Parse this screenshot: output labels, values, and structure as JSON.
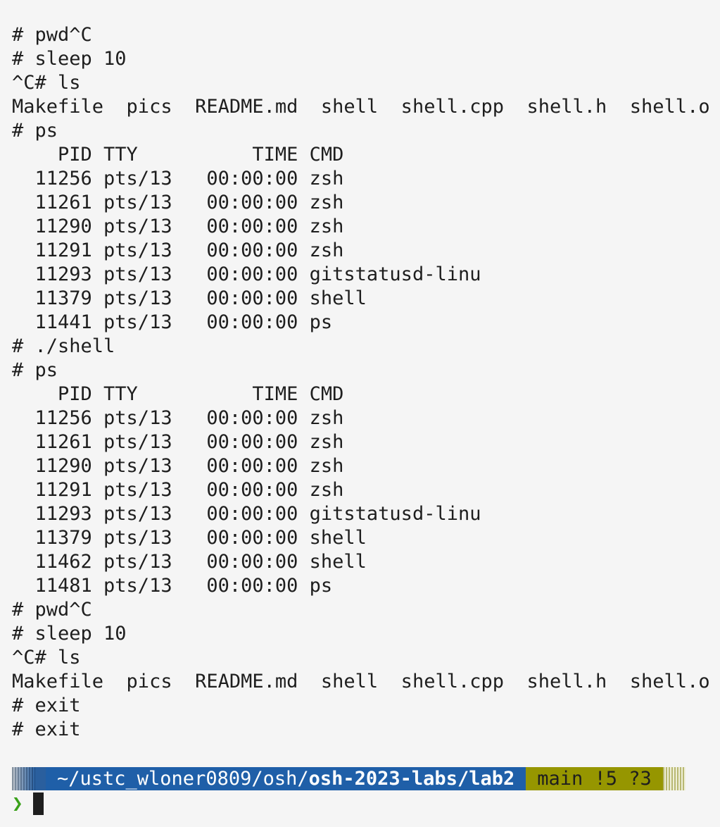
{
  "terminal": {
    "lines": [
      "# pwd^C",
      "# sleep 10",
      "^C# ls",
      "Makefile  pics  README.md  shell  shell.cpp  shell.h  shell.o",
      "# ps",
      "    PID TTY          TIME CMD",
      "  11256 pts/13   00:00:00 zsh",
      "  11261 pts/13   00:00:00 zsh",
      "  11290 pts/13   00:00:00 zsh",
      "  11291 pts/13   00:00:00 zsh",
      "  11293 pts/13   00:00:00 gitstatusd-linu",
      "  11379 pts/13   00:00:00 shell",
      "  11441 pts/13   00:00:00 ps",
      "# ./shell",
      "# ps",
      "    PID TTY          TIME CMD",
      "  11256 pts/13   00:00:00 zsh",
      "  11261 pts/13   00:00:00 zsh",
      "  11290 pts/13   00:00:00 zsh",
      "  11291 pts/13   00:00:00 zsh",
      "  11293 pts/13   00:00:00 gitstatusd-linu",
      "  11379 pts/13   00:00:00 shell",
      "  11462 pts/13   00:00:00 shell",
      "  11481 pts/13   00:00:00 ps",
      "# pwd^C",
      "# sleep 10",
      "^C# ls",
      "Makefile  pics  README.md  shell  shell.cpp  shell.h  shell.o",
      "# exit",
      "# exit"
    ]
  },
  "prompt": {
    "dir_prefix": "~/ustc_wloner0809/osh/",
    "dir_bold": "osh-2023-labs/lab2",
    "git_status": "main !5 ?3",
    "prompt_symbol": "❯"
  },
  "colors": {
    "background": "#f5f5f5",
    "dir_segment": "#1f5fa8",
    "git_segment": "#969600",
    "prompt_symbol": "#3aa11a"
  }
}
